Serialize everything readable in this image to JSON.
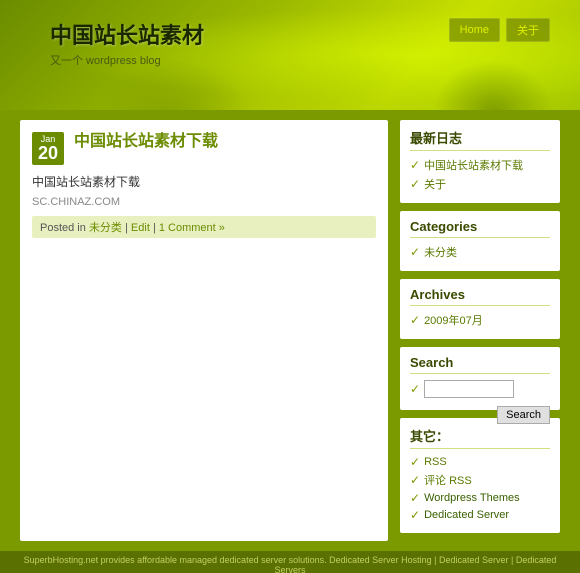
{
  "header": {
    "title": "中国站长站素材",
    "subtitle": "又一个 wordpress blog",
    "nav": [
      {
        "label": "Home",
        "id": "home"
      },
      {
        "label": "关于",
        "id": "about"
      }
    ]
  },
  "post": {
    "date_month": "Jan",
    "date_day": "20",
    "title": "中国站长站素材下载",
    "body": "中国站长站素材下载",
    "link": "SC.CHINAZ.COM",
    "meta_prefix": "Posted in",
    "category": "未分类",
    "edit": "Edit",
    "comments": "1 Comment »"
  },
  "sidebar": {
    "recent_title": "最新日志",
    "recent_items": [
      {
        "text": "中国站长站素材下载",
        "href": "#"
      },
      {
        "text": "关于",
        "href": "#"
      }
    ],
    "categories_title": "Categories",
    "categories_items": [
      {
        "text": "未分类",
        "href": "#"
      }
    ],
    "archives_title": "Archives",
    "archives_items": [
      {
        "text": "2009年07月",
        "href": "#"
      }
    ],
    "search_title": "Search",
    "search_placeholder": "",
    "search_button": "Search",
    "other_title": "其它：",
    "other_items": [
      {
        "text": "RSS",
        "href": "#"
      },
      {
        "text": "评论 RSS",
        "href": "#"
      },
      {
        "text": "Wordpress Themes",
        "href": "#"
      },
      {
        "text": "Dedicated Server",
        "href": "#"
      }
    ]
  },
  "footer": {
    "text": "SuperbHosting.net provides affordable managed dedicated server solutions. Dedicated Server Hosting | Dedicated Server | Dedicated Servers"
  }
}
